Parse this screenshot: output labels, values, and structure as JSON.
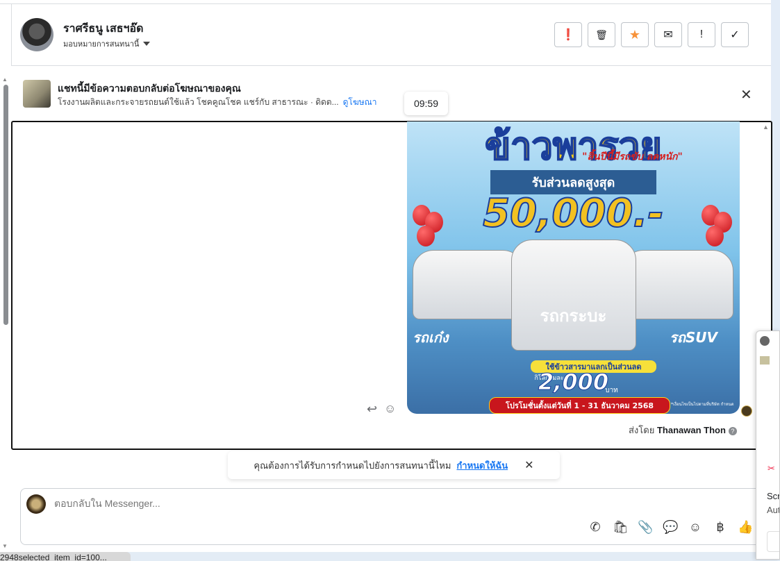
{
  "header": {
    "contact_name": "ราศรีธนู เสธฯอ๊ด",
    "assign_label": "มอบหมายการสนทนานี้",
    "actions": [
      {
        "name": "spam",
        "icon": "❗"
      },
      {
        "name": "delete",
        "icon": "🗑"
      },
      {
        "name": "star",
        "icon": "★"
      },
      {
        "name": "mark-unread",
        "icon": "✉"
      },
      {
        "name": "follow-up",
        "icon": "!"
      },
      {
        "name": "done",
        "icon": "✓"
      }
    ]
  },
  "ad_banner": {
    "title": "แชทนี้มีข้อความตอบกลับต่อโฆษณาของคุณ",
    "subtitle": "โรงงานผลิตและกระจายรถยนต์ใช้แล้ว โชคคูณโชค แชร์กับ สาธารณะ · ดิดต...",
    "link": "ดูโฆษณา",
    "close": "✕"
  },
  "message": {
    "time": "09:59",
    "sent_by_label": "ส่งโดย",
    "sender": "Thanawan Thon",
    "poster": {
      "title": "ข้าวพารวย",
      "tagline": "\"สิ้นปีนี้มีรถขับ ลดหนัก\"",
      "band": "รับส่วนลดสูงสุด",
      "amount": "50,000.-",
      "left_car": "รถเก๋ง",
      "right_car": "รถSUV",
      "center_car": "รถกระบะ",
      "exchange": "ใช้ข้าวสารมาแลกเป็นส่วนลด",
      "per_kg": "กิโลกรัมละ",
      "per_kg_amount": "2,000",
      "baht": "บาท",
      "promo": "โปรโมชั่นตั้งแต่วันที่ 1 - 31 ธันวาคม 2568",
      "note": "*เงื่อนไขเป็นไปตามที่บริษัท กำหนด"
    }
  },
  "assign_prompt": {
    "text": "คุณต้องการได้รับการกำหนดไปยังการสนทนานี้ไหม",
    "link": "กำหนดให้ฉัน",
    "close": "✕"
  },
  "composer": {
    "placeholder": "ตอบกลับใน Messenger...",
    "tools": [
      {
        "name": "phone",
        "icon": "✆"
      },
      {
        "name": "shopping-bag",
        "icon": "🛍"
      },
      {
        "name": "attachment",
        "icon": "📎"
      },
      {
        "name": "saved-reply",
        "icon": "💬"
      },
      {
        "name": "emoji",
        "icon": "☺"
      },
      {
        "name": "baht",
        "icon": "฿"
      },
      {
        "name": "like",
        "icon": "👍"
      }
    ]
  },
  "status_bar": {
    "url": "2948selected_item_id=100..."
  },
  "popup": {
    "title": "Scr",
    "subtitle": "Aut"
  },
  "colors": {
    "accent": "#1877f2",
    "star": "#f7923a"
  }
}
